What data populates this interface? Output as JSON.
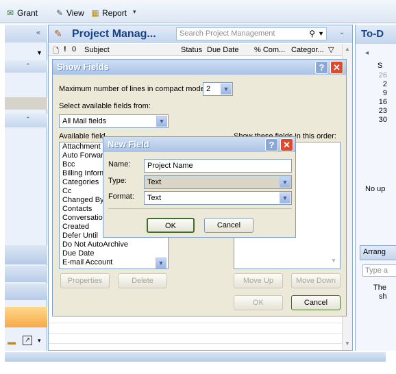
{
  "toolbar": {
    "grant_label": "Grant",
    "view_label": "View",
    "report_label": "Report"
  },
  "main": {
    "title": "Project Manag...",
    "search_placeholder": "Search Project Management",
    "columns": [
      "Subject",
      "Status",
      "Due Date",
      "% Com...",
      "Categor..."
    ]
  },
  "todo": {
    "title": "To-D",
    "calendar_header": "S",
    "calendar_days": [
      "26",
      "2",
      "9",
      "16",
      "23",
      "30"
    ],
    "no_upcoming": "No up",
    "arrange_label": "Arrang",
    "type_placeholder": "Type a",
    "note_line1": "The",
    "note_line2": "sh"
  },
  "show_fields": {
    "title": "Show Fields",
    "max_lines_label": "Maximum number of lines in compact mode:",
    "max_lines_value": "2",
    "select_from_label": "Select available fields from:",
    "select_from_value": "All Mail fields",
    "available_label": "Available field",
    "order_label": "Show these fields in this order:",
    "available_fields": [
      "Attachment",
      "Auto Forwar",
      "Bcc",
      "Billing Inform",
      "Categories",
      "Cc",
      "Changed By",
      "Contacts",
      "Conversation",
      "Created",
      "Defer Until",
      "Do Not AutoArchive",
      "Due Date",
      "E-mail Account"
    ],
    "properties_label": "Properties",
    "delete_label": "Delete",
    "move_up_label": "Move Up",
    "move_down_label": "Move Down",
    "ok_label": "OK",
    "cancel_label": "Cancel"
  },
  "new_field": {
    "title": "New Field",
    "name_label": "Name:",
    "name_value": "Project Name",
    "type_label": "Type:",
    "type_value": "Text",
    "format_label": "Format:",
    "format_value": "Text",
    "ok_label": "OK",
    "cancel_label": "Cancel"
  }
}
